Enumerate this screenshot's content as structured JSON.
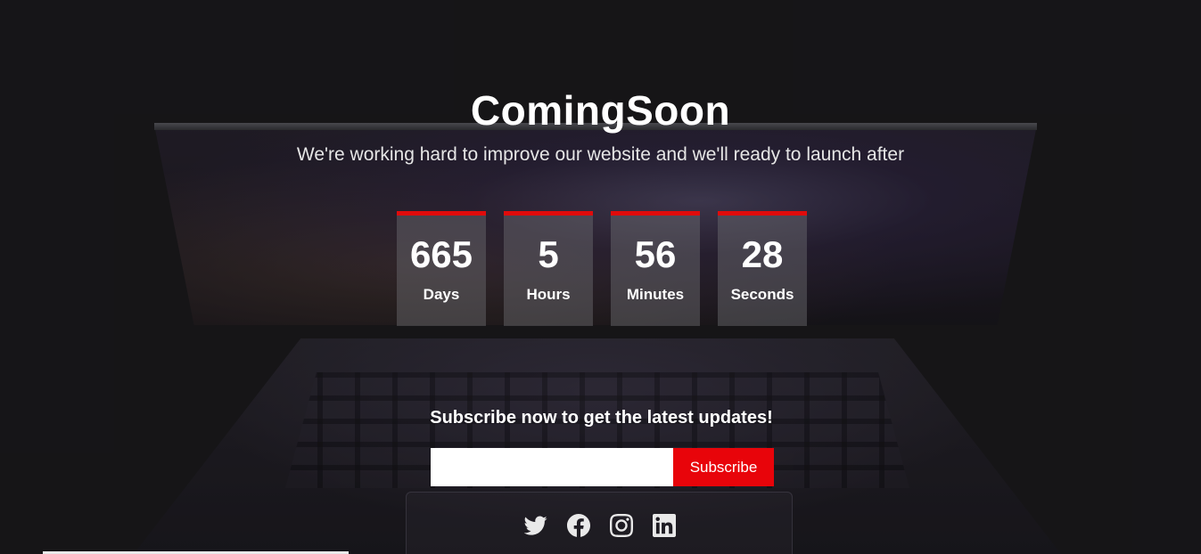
{
  "header": {
    "title": "ComingSoon",
    "subtitle": "We're working hard to improve our website and we'll ready to launch after"
  },
  "countdown": [
    {
      "value": "665",
      "label": "Days"
    },
    {
      "value": "5",
      "label": "Hours"
    },
    {
      "value": "56",
      "label": "Minutes"
    },
    {
      "value": "28",
      "label": "Seconds"
    }
  ],
  "subscribe": {
    "heading": "Subscribe now to get the latest updates!",
    "email_value": "",
    "button_label": "Subscribe"
  },
  "social": [
    {
      "icon": "twitter-icon"
    },
    {
      "icon": "facebook-icon"
    },
    {
      "icon": "instagram-icon"
    },
    {
      "icon": "linkedin-icon"
    }
  ],
  "colors": {
    "accent": "#e8040a",
    "background": "#1c1b1d",
    "text": "#ffffff"
  }
}
